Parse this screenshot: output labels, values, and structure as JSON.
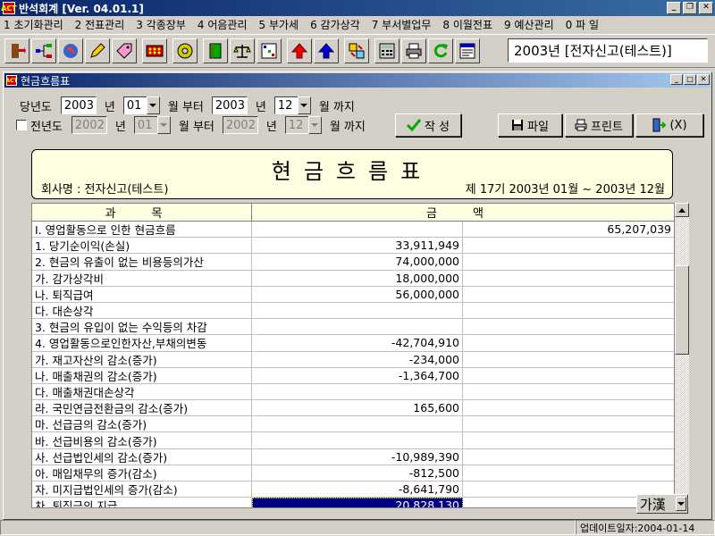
{
  "window": {
    "title": "반석회계 [Ver. 04.01.1]",
    "icon_text": "ACT"
  },
  "menu": [
    "1 초기화관리",
    "2 전표관리",
    "3 각종장부",
    "4 어음관리",
    "5 부가세",
    "6 감가상각",
    "7 부서별업무",
    "8 이월전표",
    "9 예산관리",
    "0 파 일"
  ],
  "company_display": "2003년 [전자신고(테스트)]",
  "child": {
    "title": "현금흐름표"
  },
  "filters": {
    "current": {
      "label": "당년도",
      "from_year": "2003",
      "year_unit": "년",
      "from_month": "01",
      "month_from": "월 부터",
      "to_year": "2003",
      "to_month": "12",
      "month_to": "월 까지"
    },
    "previous": {
      "label": "전년도",
      "from_year": "2002",
      "year_unit": "년",
      "from_month": "01",
      "month_from": "월 부터",
      "to_year": "2002",
      "to_month": "12",
      "month_to": "월 까지"
    }
  },
  "buttons": {
    "create": "작 성",
    "file": "파일",
    "print": "프린트",
    "exit": "(X)"
  },
  "report": {
    "title": "현금흐름표",
    "company": "회사명 : 전자신고(테스트)",
    "period": "제 17기 2003년 01월 ~ 2003년 12월"
  },
  "table": {
    "headers": [
      "과 목",
      "금 액"
    ],
    "rows": [
      [
        "Ⅰ. 영업활동으로 인한 현금흐름",
        "",
        "65,207,039"
      ],
      [
        "1. 당기순이익(손실)",
        "33,911,949",
        ""
      ],
      [
        "2. 현금의 유출이 없는 비용등의가산",
        "74,000,000",
        ""
      ],
      [
        "가. 감가상각비",
        "18,000,000",
        ""
      ],
      [
        "나. 퇴직급여",
        "56,000,000",
        ""
      ],
      [
        "다. 대손상각",
        "",
        ""
      ],
      [
        "3. 현금의 유입이 없는 수익등의 차감",
        "",
        ""
      ],
      [
        "4. 영업활동으로인한자산,부채의변동",
        "-42,704,910",
        ""
      ],
      [
        "가. 재고자산의 감소(증가)",
        "-234,000",
        ""
      ],
      [
        "나. 매출채권의 감소(증가)",
        "-1,364,700",
        ""
      ],
      [
        "다. 매출채권대손상각",
        "",
        ""
      ],
      [
        "라. 국민연금전환금의 감소(증가)",
        "165,600",
        ""
      ],
      [
        "마. 선급금의 감소(증가)",
        "",
        ""
      ],
      [
        "바. 선급비용의 감소(증가)",
        "",
        ""
      ],
      [
        "사. 선급법인세의 감소(증가)",
        "-10,989,390",
        ""
      ],
      [
        "아. 매입채무의 증가(감소)",
        "-812,500",
        ""
      ],
      [
        "자. 미지급법인세의 증가(감소)",
        "-8,641,790",
        ""
      ],
      [
        "차. 퇴직금의 지급",
        "20,828,130",
        ""
      ]
    ]
  },
  "ime": "가漢",
  "status": {
    "update": "업데이트일자:2004-01-14"
  }
}
